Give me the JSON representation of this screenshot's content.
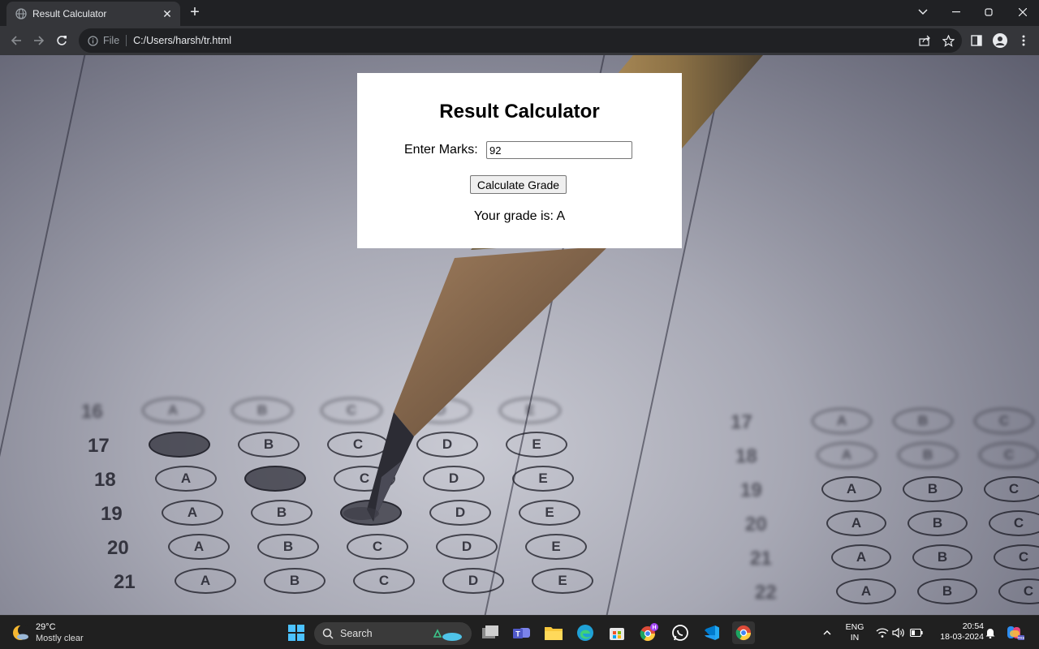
{
  "browser": {
    "tab_title": "Result Calculator",
    "omnibox_scheme": "File",
    "url": "C:/Users/harsh/tr.html"
  },
  "page": {
    "heading": "Result Calculator",
    "marks_label": "Enter Marks:",
    "marks_value": "92",
    "button_label": "Calculate Grade",
    "result_text": "Your grade is: A"
  },
  "background_sheet": {
    "left_rows": [
      {
        "num": "16",
        "options": [
          "A",
          "B",
          "C",
          "D",
          "E"
        ]
      },
      {
        "num": "17",
        "options": [
          "",
          "B",
          "C",
          "D",
          "E"
        ],
        "filled": [
          0
        ]
      },
      {
        "num": "18",
        "options": [
          "A",
          "",
          "C",
          "D",
          "E"
        ],
        "filled": [
          1
        ]
      },
      {
        "num": "19",
        "options": [
          "A",
          "B",
          "",
          "D",
          "E"
        ],
        "filled": [
          2
        ]
      },
      {
        "num": "20",
        "options": [
          "A",
          "B",
          "C",
          "D",
          "E"
        ]
      },
      {
        "num": "21",
        "options": [
          "A",
          "B",
          "C",
          "D",
          "E"
        ]
      }
    ],
    "right_rows": [
      {
        "num": "17",
        "options": [
          "A",
          "B",
          "C"
        ]
      },
      {
        "num": "18",
        "options": [
          "A",
          "B",
          "C"
        ]
      },
      {
        "num": "19",
        "options": [
          "A",
          "B",
          "C"
        ]
      },
      {
        "num": "20",
        "options": [
          "A",
          "B",
          "C"
        ]
      },
      {
        "num": "21",
        "options": [
          "A",
          "B",
          "C"
        ]
      },
      {
        "num": "22",
        "options": [
          "A",
          "B",
          "C"
        ]
      }
    ]
  },
  "taskbar": {
    "weather_temp": "29°C",
    "weather_condition": "Mostly clear",
    "search_label": "Search",
    "language_line1": "ENG",
    "language_line2": "IN",
    "time": "20:54",
    "date": "18-03-2024",
    "apps": [
      "start-icon",
      "file-manager-icon",
      "teams-icon",
      "file-explorer-icon",
      "edge-icon",
      "store-icon",
      "chrome-profile-icon",
      "whatsapp-icon",
      "vscode-icon",
      "chrome-icon"
    ]
  },
  "colors": {
    "chrome_dark": "#202124",
    "chrome_toolbar": "#35363a",
    "taskbar": "#202020",
    "card_bg": "#ffffff"
  }
}
